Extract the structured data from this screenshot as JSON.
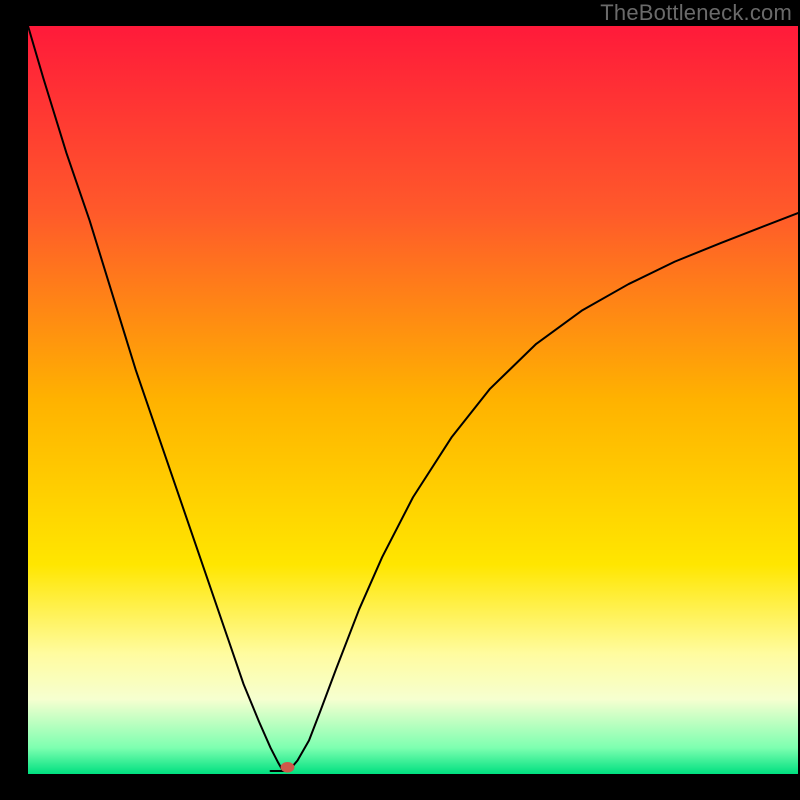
{
  "watermark": "TheBottleneck.com",
  "chart_data": {
    "type": "line",
    "title": "",
    "xlabel": "",
    "ylabel": "",
    "xlim": [
      0,
      100
    ],
    "ylim": [
      0,
      100
    ],
    "grid": false,
    "background_gradient": {
      "stops": [
        {
          "offset": 0.0,
          "color": "#ff1a3a"
        },
        {
          "offset": 0.25,
          "color": "#ff5a2a"
        },
        {
          "offset": 0.5,
          "color": "#ffb200"
        },
        {
          "offset": 0.72,
          "color": "#ffe600"
        },
        {
          "offset": 0.84,
          "color": "#fffca0"
        },
        {
          "offset": 0.9,
          "color": "#f6ffd0"
        },
        {
          "offset": 0.965,
          "color": "#7dffb0"
        },
        {
          "offset": 1.0,
          "color": "#00e080"
        }
      ]
    },
    "series": [
      {
        "name": "bottleneck-curve",
        "color": "#000000",
        "stroke_width": 2,
        "x": [
          0,
          2,
          5,
          8,
          11,
          14,
          17,
          20,
          23,
          26,
          28,
          30,
          31.5,
          32.5,
          33,
          33.5,
          34,
          35,
          36.5,
          38,
          40,
          43,
          46,
          50,
          55,
          60,
          66,
          72,
          78,
          84,
          90,
          95,
          100
        ],
        "y": [
          100,
          93,
          83,
          74,
          64,
          54,
          45,
          36,
          27,
          18,
          12,
          7,
          3.5,
          1.5,
          0.6,
          0.4,
          0.6,
          1.8,
          4.5,
          8.5,
          14,
          22,
          29,
          37,
          45,
          51.5,
          57.5,
          62,
          65.5,
          68.5,
          71,
          73,
          75
        ]
      },
      {
        "name": "baseline-flat-left",
        "color": "#000000",
        "stroke_width": 2,
        "x": [
          31.5,
          33.5
        ],
        "y": [
          0.4,
          0.4
        ]
      }
    ],
    "marker": {
      "name": "minimum-marker",
      "x": 33.7,
      "y": 0.9,
      "rx": 0.9,
      "ry": 0.7,
      "color": "#cf5a4a"
    }
  }
}
